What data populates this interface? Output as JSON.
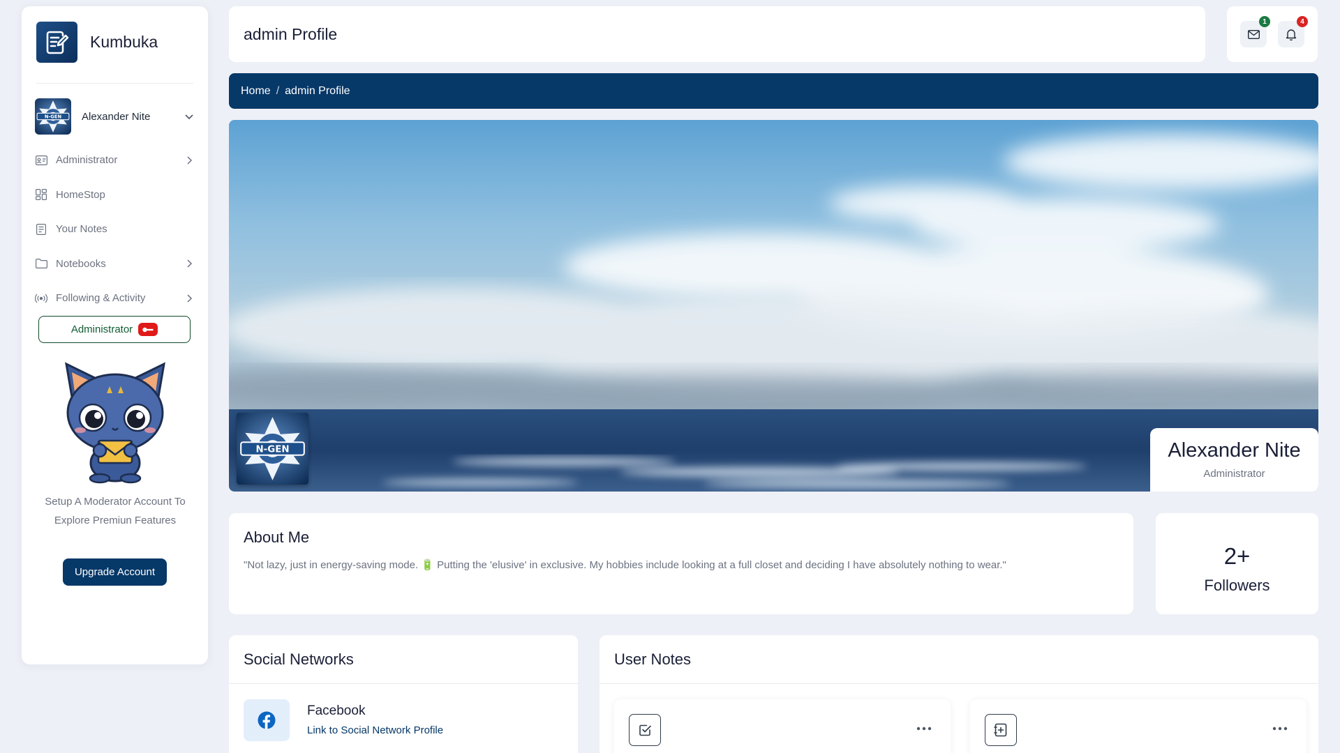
{
  "app": {
    "name": "Kumbuka"
  },
  "sidebar": {
    "user_name": "Alexander Nite",
    "nav": [
      {
        "label": "Administrator",
        "icon": "id-card-icon",
        "expandable": true
      },
      {
        "label": "HomeStop",
        "icon": "dashboard-icon",
        "expandable": false
      },
      {
        "label": "Your Notes",
        "icon": "notes-icon",
        "expandable": false
      },
      {
        "label": "Notebooks",
        "icon": "folder-icon",
        "expandable": true
      },
      {
        "label": "Following & Activity",
        "icon": "broadcast-icon",
        "expandable": true
      }
    ],
    "admin_button_label": "Administrator",
    "promo_text": "Setup A Moderator Account To Explore Premiun Features",
    "upgrade_button_label": "Upgrade Account"
  },
  "header": {
    "title": "admin Profile",
    "messages_count": "1",
    "notifications_count": "4"
  },
  "breadcrumb": {
    "home": "Home",
    "current": "admin Profile"
  },
  "profile": {
    "name": "Alexander Nite",
    "role": "Administrator",
    "avatar_text": "N-GEN"
  },
  "about": {
    "title": "About Me",
    "text": "\"Not lazy, just in energy-saving mode. 🔋 Putting the 'elusive' in exclusive. My hobbies include looking at a full closet and deciding I have absolutely nothing to wear.\""
  },
  "followers": {
    "count": "2+",
    "label": "Followers"
  },
  "social": {
    "title": "Social Networks",
    "items": [
      {
        "name": "Facebook",
        "link_text": "Link to Social Network Profile",
        "icon": "facebook-icon"
      }
    ]
  },
  "notes": {
    "title": "User Notes"
  },
  "colors": {
    "primary": "#063868",
    "background": "#eef0f7",
    "message_badge": "#1b7a43",
    "notification_badge": "#d92323",
    "admin_badge": "#e01919"
  }
}
